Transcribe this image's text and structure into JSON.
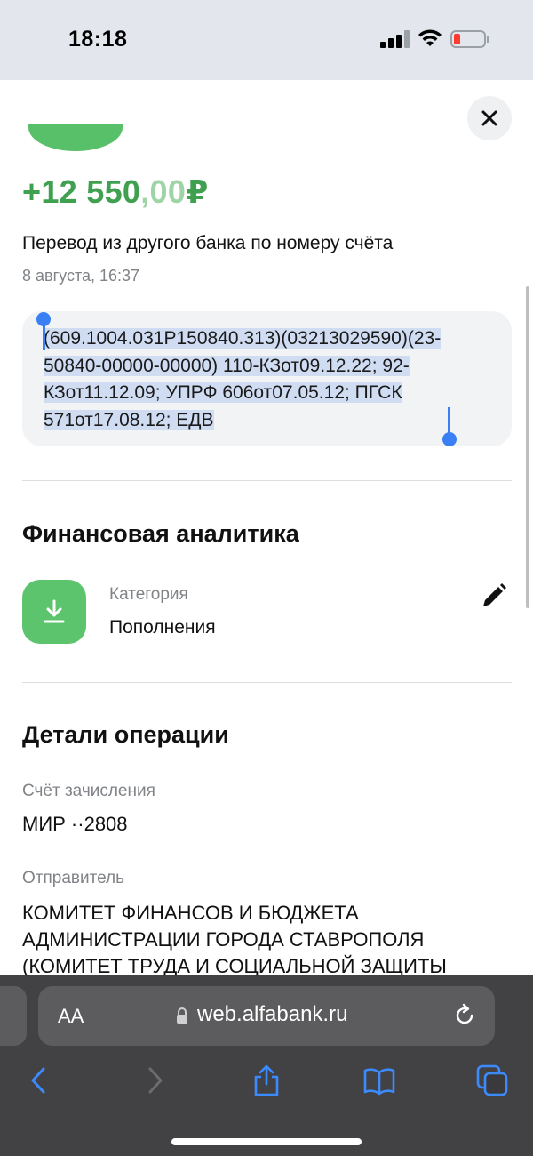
{
  "status_bar": {
    "time": "18:18"
  },
  "transaction": {
    "amount_main": "+12 550",
    "amount_decimal": ",00",
    "currency": "₽",
    "title": "Перевод из другого банка по номеру счёта",
    "date": "8 августа, 16:37",
    "message": "(609.1004.031Р150840.313)(03213029590)(23-50840-00000-00000) 110-КЗот09.12.22; 92-КЗот11.12.09; УПРФ 606от07.05.12; ПГСК 571от17.08.12; ЕДВ"
  },
  "analytics": {
    "title": "Финансовая аналитика",
    "category_label": "Категория",
    "category_value": "Пополнения"
  },
  "details": {
    "title": "Детали операции",
    "account_label": "Счёт зачисления",
    "account_value": "МИР ··2808",
    "sender_label": "Отправитель",
    "sender_value": "КОМИТЕТ ФИНАНСОВ И БЮДЖЕТА АДМИНИСТРАЦИИ ГОРОДА СТАВРОПОЛЯ (КОМИТЕТ ТРУДА И СОЦИАЛЬНОЙ ЗАЩИТЫ"
  },
  "browser": {
    "text_size_label": "AA",
    "url": "web.alfabank.ru"
  },
  "colors": {
    "accent_green": "#3fa050",
    "selection_blue": "#3b7ff5"
  }
}
